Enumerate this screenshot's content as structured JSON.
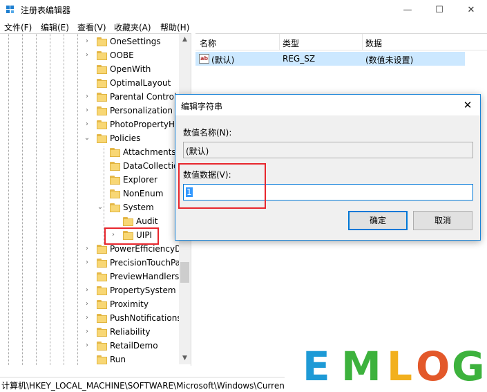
{
  "window": {
    "title": "注册表编辑器",
    "minimize_glyph": "—",
    "maximize_glyph": "☐",
    "close_glyph": "✕"
  },
  "menu": [
    "文件(F)",
    "编辑(E)",
    "查看(V)",
    "收藏夹(A)",
    "帮助(H)"
  ],
  "tree": {
    "items": [
      {
        "label": "OneSettings",
        "expander": "›"
      },
      {
        "label": "OOBE",
        "expander": "›"
      },
      {
        "label": "OpenWith",
        "expander": ""
      },
      {
        "label": "OptimalLayout",
        "expander": ""
      },
      {
        "label": "Parental Controls",
        "expander": "›"
      },
      {
        "label": "Personalization",
        "expander": "›"
      },
      {
        "label": "PhotoPropertyHandler",
        "expander": "›"
      },
      {
        "label": "Policies",
        "expander": "⌄"
      },
      {
        "label": "Attachments",
        "expander": ""
      },
      {
        "label": "DataCollection",
        "expander": ""
      },
      {
        "label": "Explorer",
        "expander": ""
      },
      {
        "label": "NonEnum",
        "expander": ""
      },
      {
        "label": "System",
        "expander": "⌄"
      },
      {
        "label": "Audit",
        "expander": ""
      },
      {
        "label": "UIPI",
        "expander": "›"
      },
      {
        "label": "PowerEfficiencyDiagnostics",
        "expander": "›"
      },
      {
        "label": "PrecisionTouchPad",
        "expander": "›"
      },
      {
        "label": "PreviewHandlers",
        "expander": ""
      },
      {
        "label": "PropertySystem",
        "expander": "›"
      },
      {
        "label": "Proximity",
        "expander": "›"
      },
      {
        "label": "PushNotifications",
        "expander": "›"
      },
      {
        "label": "Reliability",
        "expander": "›"
      },
      {
        "label": "RetailDemo",
        "expander": "›"
      },
      {
        "label": "Run",
        "expander": ""
      }
    ]
  },
  "list": {
    "columns": [
      "名称",
      "类型",
      "数据"
    ],
    "rows": [
      {
        "icon": "ab",
        "name": "(默认)",
        "type": "REG_SZ",
        "data": "(数值未设置)"
      }
    ]
  },
  "status": {
    "path": "计算机\\HKEY_LOCAL_MACHINE\\SOFTWARE\\Microsoft\\Windows\\CurrentVersion\\Policies\\System\\UIPI"
  },
  "dialog": {
    "title": "编辑字符串",
    "close_glyph": "✕",
    "name_label": "数值名称(N):",
    "name_value": "(默认)",
    "data_label": "数值数据(V):",
    "data_value": "1",
    "ok_label": "确定",
    "cancel_label": "取消"
  },
  "watermark": {
    "letters": [
      "E",
      "M",
      "L",
      "O",
      "G"
    ],
    "colors": [
      "#1e9ad6",
      "#3db23d",
      "#f2b01e",
      "#e3582a",
      "#3db23d"
    ]
  },
  "colors": {
    "highlight_red": "#e8262d",
    "selection_blue": "#cce8ff",
    "accent_blue": "#0078d7"
  }
}
